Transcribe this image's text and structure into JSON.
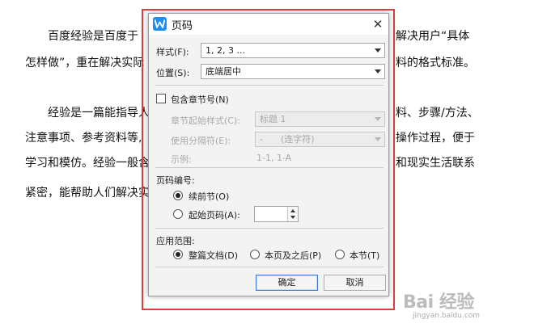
{
  "document": {
    "lines": [
      {
        "left": "百度经验是百度于",
        "right": "解决用户“具体"
      },
      {
        "left": "怎样做”，重在解决实际",
        "right": "料的格式标准。"
      },
      {
        "left": "经验是一篇能指导人",
        "right": "料、步骤/方法、"
      },
      {
        "left": "注意事项、参考资料等,",
        "right": "操作过程，便于"
      },
      {
        "left": "学习和模仿。经验一般含",
        "right": "和现实生活联系"
      },
      {
        "left": "紧密，能帮助人们解决实",
        "right": ""
      }
    ]
  },
  "dialog": {
    "title": "页码",
    "close_glyph": "✕",
    "style_label": "样式(F):",
    "style_value": "1, 2, 3 ...",
    "position_label": "位置(S):",
    "position_value": "底端居中",
    "include_chapter_label": "包含章节号(N)",
    "chapter_style_label": "章节起始样式(C):",
    "chapter_style_value": "标题 1",
    "separator_label": "使用分隔符(E):",
    "separator_value": "-　　(连字符)",
    "example_label": "示例:",
    "example_value": "1-1, 1-A",
    "numbering_title": "页码编号:",
    "continue_label": "续前节(O)",
    "start_label": "起始页码(A):",
    "start_value": "",
    "scope_title": "应用范围:",
    "scope_whole": "整篇文档(D)",
    "scope_after": "本页及之后(P)",
    "scope_section": "本节(T)",
    "ok_label": "确定",
    "cancel_label": "取消"
  },
  "watermark": {
    "logo": "Bai 经验",
    "sub": "jingyan.baidu.com"
  },
  "colors": {
    "highlight_frame": "#e23b3b",
    "app_icon": "#1e8ef0",
    "primary_button_border": "#3d7bd4"
  }
}
